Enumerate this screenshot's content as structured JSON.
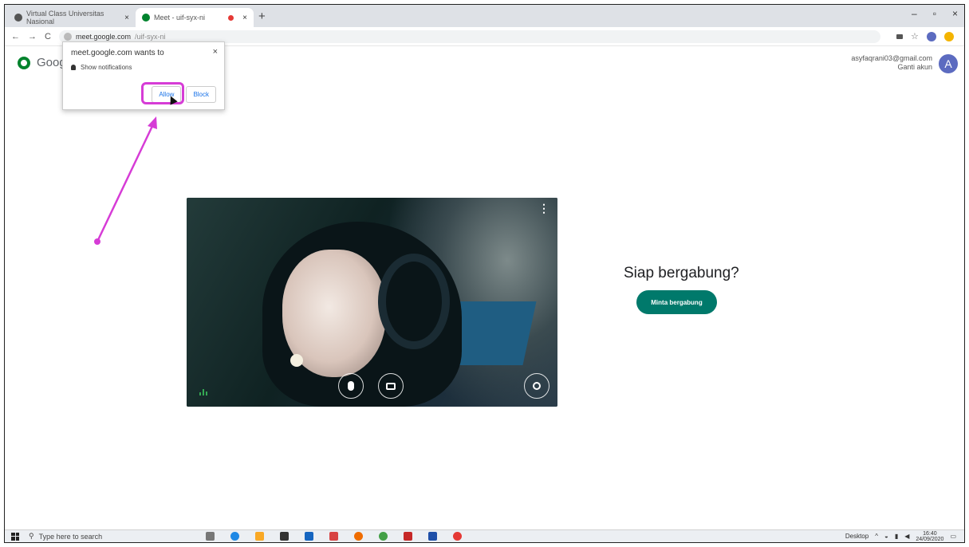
{
  "browser": {
    "tabs": [
      {
        "title": "Virtual Class Universitas Nasional",
        "close": "×"
      },
      {
        "title": "Meet - uif-syx-ni",
        "close": "×"
      }
    ],
    "new_tab": "+",
    "window_controls": {
      "minimize": "–",
      "maximize": "▫",
      "close": "×"
    },
    "nav": {
      "back": "←",
      "forward": "→",
      "reload": "C"
    },
    "url_host": "meet.google.com",
    "url_path": "/uif-syx-ni"
  },
  "meet": {
    "logo_text": "Goog",
    "account_email": "asyfaqrani03@gmail.com",
    "account_action": "Ganti akun",
    "avatar_letter": "A",
    "ready_text": "Siap bergabung?",
    "join_button": "Minta bergabung",
    "video_menu": "⋮"
  },
  "popup": {
    "title": "meet.google.com wants to",
    "permission": "Show notifications",
    "close": "×",
    "allow": "Allow",
    "block": "Block"
  },
  "taskbar": {
    "search_placeholder": "Type here to search",
    "desktop_label": "Desktop",
    "time": "16:40",
    "date": "24/09/2020"
  },
  "colors": {
    "meet_green": "#00796b",
    "annotation": "#d63cd6",
    "avatar": "#5c6bc0"
  }
}
